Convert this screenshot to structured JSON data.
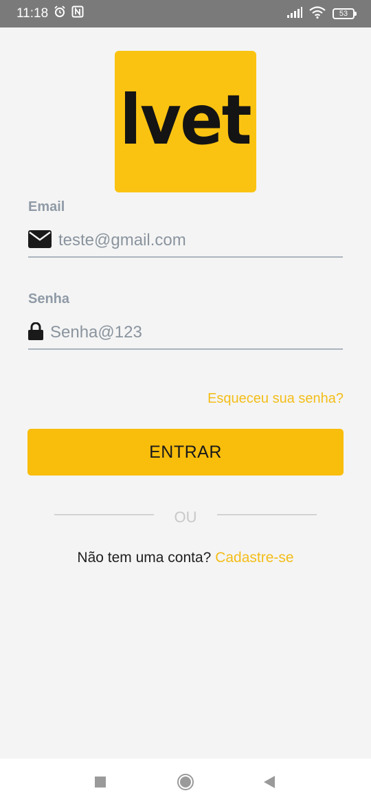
{
  "status_bar": {
    "time": "11:18",
    "battery_level": "53",
    "icons": [
      "alarm-icon",
      "nfc-icon",
      "signal-icon",
      "wifi-icon",
      "battery-icon"
    ]
  },
  "logo": {
    "text": "lvet"
  },
  "email": {
    "label": "Email",
    "value": "teste@gmail.com",
    "icon": "envelope-icon"
  },
  "password": {
    "label": "Senha",
    "value": "Senha@123",
    "icon": "lock-icon"
  },
  "forgot_password": "Esqueceu sua senha?",
  "login_button": "ENTRAR",
  "divider_text": "OU",
  "signup": {
    "prompt": "Não tem uma conta?",
    "link": "Cadastre-se"
  },
  "colors": {
    "accent": "#f9bd0b",
    "link": "#f3bd17",
    "background": "#f4f4f4",
    "label": "#8f9aa6"
  },
  "nav_bar": {
    "icons": [
      "recents-icon",
      "home-icon",
      "back-icon"
    ]
  }
}
